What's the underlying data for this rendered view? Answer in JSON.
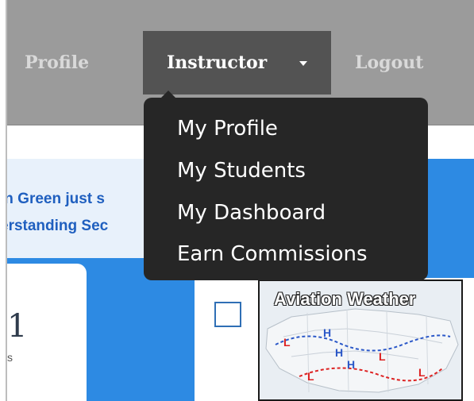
{
  "nav": {
    "profile_label": "Profile",
    "instructor_label": "Instructor",
    "logout_label": "Logout"
  },
  "dropdown": {
    "items": [
      {
        "label": "My Profile"
      },
      {
        "label": "My Students"
      },
      {
        "label": "My Dashboard"
      },
      {
        "label": "Earn Commissions"
      }
    ]
  },
  "notice": {
    "line1": "in Green just s",
    "line2": "erstanding Sec"
  },
  "card": {
    "big_number": "1",
    "small_text": "s"
  },
  "thumbnail": {
    "title": "Aviation Weather"
  },
  "colors": {
    "navbar": "#9b9b9b",
    "navbar_active": "#535353",
    "dropdown_bg": "#262626",
    "accent_blue": "#2d8ae3",
    "notice_text": "#1f5fbf"
  }
}
